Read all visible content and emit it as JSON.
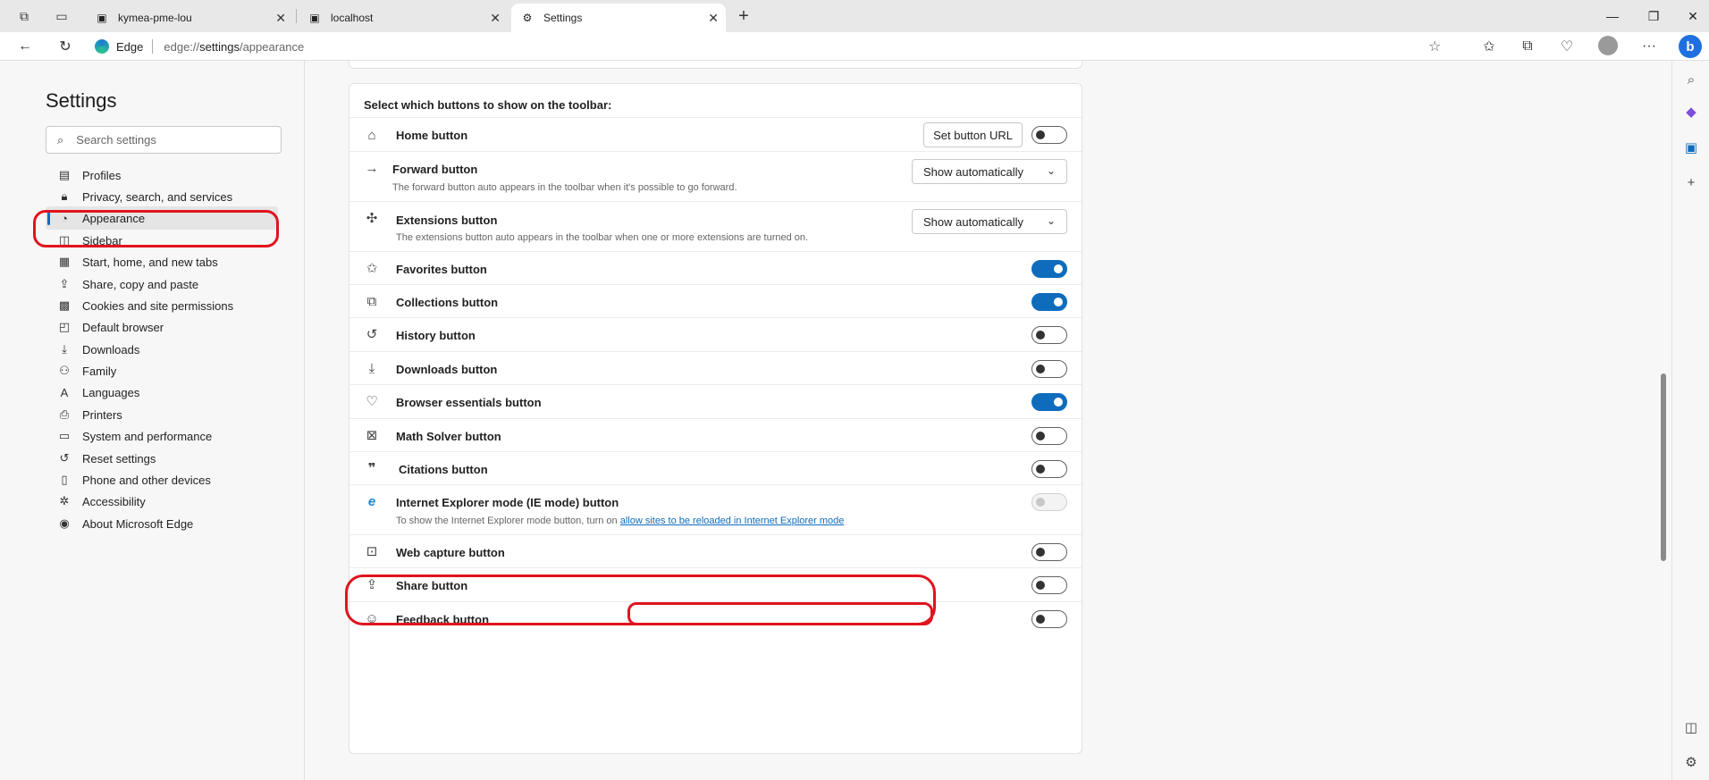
{
  "tabs": [
    {
      "title": "kymea-pme-lou",
      "active": false
    },
    {
      "title": "localhost",
      "active": false
    },
    {
      "title": "Settings",
      "active": true
    }
  ],
  "address": {
    "brand": "Edge",
    "scheme": "edge://",
    "host": "settings",
    "path": "/appearance"
  },
  "sidebar": {
    "title": "Settings",
    "search_placeholder": "Search settings",
    "items": [
      {
        "label": "Profiles",
        "icon": "profiles-icon",
        "active": false
      },
      {
        "label": "Privacy, search, and services",
        "icon": "lock-icon",
        "active": false
      },
      {
        "label": "Appearance",
        "icon": "palette-icon",
        "active": true
      },
      {
        "label": "Sidebar",
        "icon": "sidebar-icon",
        "active": false
      },
      {
        "label": "Start, home, and new tabs",
        "icon": "grid-icon",
        "active": false
      },
      {
        "label": "Share, copy and paste",
        "icon": "share-icon",
        "active": false
      },
      {
        "label": "Cookies and site permissions",
        "icon": "permissions-icon",
        "active": false
      },
      {
        "label": "Default browser",
        "icon": "browser-icon",
        "active": false
      },
      {
        "label": "Downloads",
        "icon": "download-icon",
        "active": false
      },
      {
        "label": "Family",
        "icon": "family-icon",
        "active": false
      },
      {
        "label": "Languages",
        "icon": "languages-icon",
        "active": false
      },
      {
        "label": "Printers",
        "icon": "printer-icon",
        "active": false
      },
      {
        "label": "System and performance",
        "icon": "laptop-icon",
        "active": false
      },
      {
        "label": "Reset settings",
        "icon": "reset-icon",
        "active": false
      },
      {
        "label": "Phone and other devices",
        "icon": "phone-icon",
        "active": false
      },
      {
        "label": "Accessibility",
        "icon": "accessibility-icon",
        "active": false
      },
      {
        "label": "About Microsoft Edge",
        "icon": "edge-icon",
        "active": false
      }
    ]
  },
  "toolbar_section": {
    "header": "Select which buttons to show on the toolbar:",
    "home": {
      "label": "Home button",
      "set_url_label": "Set button URL",
      "on": false
    },
    "forward": {
      "label": "Forward button",
      "desc": "The forward button auto appears in the toolbar when it's possible to go forward.",
      "dropdown": "Show automatically"
    },
    "extensions": {
      "label": "Extensions button",
      "desc": "The extensions button auto appears in the toolbar when one or more extensions are turned on.",
      "dropdown": "Show automatically"
    },
    "favorites": {
      "label": "Favorites button",
      "on": true
    },
    "collections": {
      "label": "Collections button",
      "on": true
    },
    "history": {
      "label": "History button",
      "on": false
    },
    "downloads": {
      "label": "Downloads button",
      "on": false
    },
    "essentials": {
      "label": "Browser essentials button",
      "on": true
    },
    "math": {
      "label": "Math Solver button",
      "on": false
    },
    "citations": {
      "label": "Citations button",
      "on": false
    },
    "ie_mode": {
      "label": "Internet Explorer mode (IE mode) button",
      "desc_prefix": "To show the Internet Explorer mode button, turn on",
      "link": "allow sites to be reloaded in Internet Explorer mode",
      "on": false,
      "disabled": true
    },
    "web_capture": {
      "label": "Web capture button",
      "on": false
    },
    "share": {
      "label": "Share button",
      "on": false
    },
    "feedback": {
      "label": "Feedback button",
      "on": false
    }
  },
  "colors": {
    "accent": "#0f6cbd",
    "highlight": "#e0141e"
  }
}
